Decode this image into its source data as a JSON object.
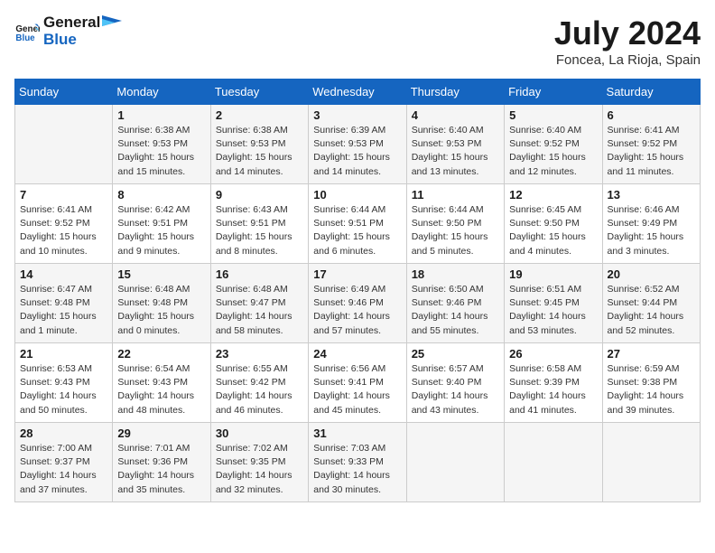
{
  "header": {
    "logo_general": "General",
    "logo_blue": "Blue",
    "month_title": "July 2024",
    "location": "Foncea, La Rioja, Spain"
  },
  "days_of_week": [
    "Sunday",
    "Monday",
    "Tuesday",
    "Wednesday",
    "Thursday",
    "Friday",
    "Saturday"
  ],
  "weeks": [
    [
      {
        "day": "",
        "info": ""
      },
      {
        "day": "1",
        "info": "Sunrise: 6:38 AM\nSunset: 9:53 PM\nDaylight: 15 hours\nand 15 minutes."
      },
      {
        "day": "2",
        "info": "Sunrise: 6:38 AM\nSunset: 9:53 PM\nDaylight: 15 hours\nand 14 minutes."
      },
      {
        "day": "3",
        "info": "Sunrise: 6:39 AM\nSunset: 9:53 PM\nDaylight: 15 hours\nand 14 minutes."
      },
      {
        "day": "4",
        "info": "Sunrise: 6:40 AM\nSunset: 9:53 PM\nDaylight: 15 hours\nand 13 minutes."
      },
      {
        "day": "5",
        "info": "Sunrise: 6:40 AM\nSunset: 9:52 PM\nDaylight: 15 hours\nand 12 minutes."
      },
      {
        "day": "6",
        "info": "Sunrise: 6:41 AM\nSunset: 9:52 PM\nDaylight: 15 hours\nand 11 minutes."
      }
    ],
    [
      {
        "day": "7",
        "info": "Sunrise: 6:41 AM\nSunset: 9:52 PM\nDaylight: 15 hours\nand 10 minutes."
      },
      {
        "day": "8",
        "info": "Sunrise: 6:42 AM\nSunset: 9:51 PM\nDaylight: 15 hours\nand 9 minutes."
      },
      {
        "day": "9",
        "info": "Sunrise: 6:43 AM\nSunset: 9:51 PM\nDaylight: 15 hours\nand 8 minutes."
      },
      {
        "day": "10",
        "info": "Sunrise: 6:44 AM\nSunset: 9:51 PM\nDaylight: 15 hours\nand 6 minutes."
      },
      {
        "day": "11",
        "info": "Sunrise: 6:44 AM\nSunset: 9:50 PM\nDaylight: 15 hours\nand 5 minutes."
      },
      {
        "day": "12",
        "info": "Sunrise: 6:45 AM\nSunset: 9:50 PM\nDaylight: 15 hours\nand 4 minutes."
      },
      {
        "day": "13",
        "info": "Sunrise: 6:46 AM\nSunset: 9:49 PM\nDaylight: 15 hours\nand 3 minutes."
      }
    ],
    [
      {
        "day": "14",
        "info": "Sunrise: 6:47 AM\nSunset: 9:48 PM\nDaylight: 15 hours\nand 1 minute."
      },
      {
        "day": "15",
        "info": "Sunrise: 6:48 AM\nSunset: 9:48 PM\nDaylight: 15 hours\nand 0 minutes."
      },
      {
        "day": "16",
        "info": "Sunrise: 6:48 AM\nSunset: 9:47 PM\nDaylight: 14 hours\nand 58 minutes."
      },
      {
        "day": "17",
        "info": "Sunrise: 6:49 AM\nSunset: 9:46 PM\nDaylight: 14 hours\nand 57 minutes."
      },
      {
        "day": "18",
        "info": "Sunrise: 6:50 AM\nSunset: 9:46 PM\nDaylight: 14 hours\nand 55 minutes."
      },
      {
        "day": "19",
        "info": "Sunrise: 6:51 AM\nSunset: 9:45 PM\nDaylight: 14 hours\nand 53 minutes."
      },
      {
        "day": "20",
        "info": "Sunrise: 6:52 AM\nSunset: 9:44 PM\nDaylight: 14 hours\nand 52 minutes."
      }
    ],
    [
      {
        "day": "21",
        "info": "Sunrise: 6:53 AM\nSunset: 9:43 PM\nDaylight: 14 hours\nand 50 minutes."
      },
      {
        "day": "22",
        "info": "Sunrise: 6:54 AM\nSunset: 9:43 PM\nDaylight: 14 hours\nand 48 minutes."
      },
      {
        "day": "23",
        "info": "Sunrise: 6:55 AM\nSunset: 9:42 PM\nDaylight: 14 hours\nand 46 minutes."
      },
      {
        "day": "24",
        "info": "Sunrise: 6:56 AM\nSunset: 9:41 PM\nDaylight: 14 hours\nand 45 minutes."
      },
      {
        "day": "25",
        "info": "Sunrise: 6:57 AM\nSunset: 9:40 PM\nDaylight: 14 hours\nand 43 minutes."
      },
      {
        "day": "26",
        "info": "Sunrise: 6:58 AM\nSunset: 9:39 PM\nDaylight: 14 hours\nand 41 minutes."
      },
      {
        "day": "27",
        "info": "Sunrise: 6:59 AM\nSunset: 9:38 PM\nDaylight: 14 hours\nand 39 minutes."
      }
    ],
    [
      {
        "day": "28",
        "info": "Sunrise: 7:00 AM\nSunset: 9:37 PM\nDaylight: 14 hours\nand 37 minutes."
      },
      {
        "day": "29",
        "info": "Sunrise: 7:01 AM\nSunset: 9:36 PM\nDaylight: 14 hours\nand 35 minutes."
      },
      {
        "day": "30",
        "info": "Sunrise: 7:02 AM\nSunset: 9:35 PM\nDaylight: 14 hours\nand 32 minutes."
      },
      {
        "day": "31",
        "info": "Sunrise: 7:03 AM\nSunset: 9:33 PM\nDaylight: 14 hours\nand 30 minutes."
      },
      {
        "day": "",
        "info": ""
      },
      {
        "day": "",
        "info": ""
      },
      {
        "day": "",
        "info": ""
      }
    ]
  ]
}
